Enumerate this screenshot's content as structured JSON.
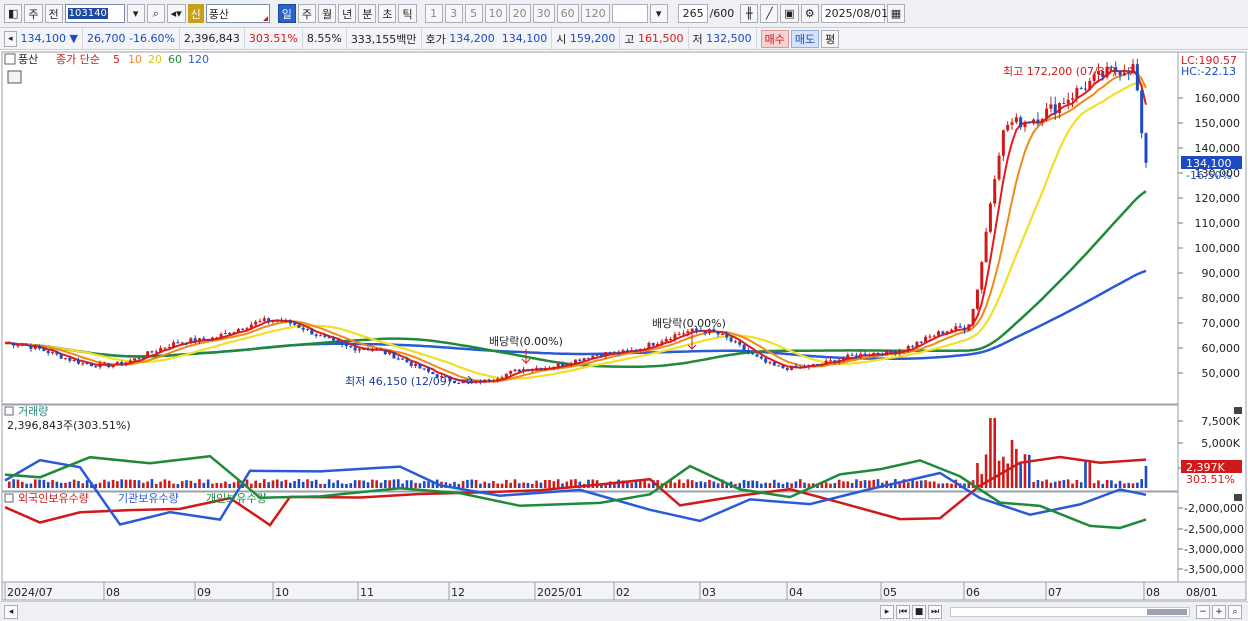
{
  "toolbar": {
    "market": "주",
    "prev": "전",
    "code": "103140",
    "sin": "신",
    "name": "풍산",
    "periods": [
      "일",
      "주",
      "월",
      "년",
      "분",
      "초",
      "틱"
    ],
    "active_period": "일",
    "intervals": [
      "1",
      "3",
      "5",
      "10",
      "20",
      "30",
      "60",
      "120"
    ],
    "count": "265",
    "total": "/600",
    "date": "2025/08/01"
  },
  "quote": {
    "price": "134,100",
    "arrow": "▼",
    "change": "26,700",
    "change_pct": "-16.60%",
    "volume": "2,396,843",
    "vol_ratio": "303.51%",
    "turnover": "8.55%",
    "amount": "333,155백만",
    "hoga_label": "호가",
    "ask": "134,200",
    "bid": "134,100",
    "open_label": "시",
    "open": "159,200",
    "high_label": "고",
    "high": "161,500",
    "low_label": "저",
    "low": "132,500",
    "buy": "매수",
    "sell": "매도",
    "eval": "평"
  },
  "price_panel": {
    "stock_tag": "풍산",
    "legend_prefix": "종가 단순",
    "ma": [
      {
        "p": "5",
        "color": "#e01c1c"
      },
      {
        "p": "10",
        "color": "#ef8a1a"
      },
      {
        "p": "20",
        "color": "#e8e020"
      },
      {
        "p": "60",
        "color": "#1e8a3a"
      },
      {
        "p": "120",
        "color": "#2a5ad8"
      }
    ],
    "lc": "LC:190.57",
    "hc": "HC:-22.13",
    "current_price": "134,100",
    "current_pct": "-16.50%",
    "max_note": "최고 172,200 (07/30)",
    "min_note": "최저 46,150 (12/09)",
    "div1": "배당락(0.00%)",
    "div2": "배당락(0.00%)",
    "y_ticks": [
      "160,000",
      "150,000",
      "140,000",
      "130,000",
      "120,000",
      "110,000",
      "100,000",
      "90,000",
      "80,000",
      "70,000",
      "60,000",
      "50,000"
    ]
  },
  "volume_panel": {
    "title": "거래량",
    "value": "2,396,843주(303.51%)",
    "y_ticks": [
      "7,500K",
      "5,000K",
      "2,500K"
    ],
    "current": "2,397K",
    "current_pct": "303.51%"
  },
  "holding_panel": {
    "labels": [
      "외국인보유수량",
      "기관보유수량",
      "개인보유수량"
    ],
    "y_ticks": [
      "-2,000,000",
      "-2,500,000",
      "-3,000,000",
      "-3,500,000"
    ]
  },
  "x_axis": [
    "2024/07",
    "08",
    "09",
    "10",
    "11",
    "12",
    "2025/01",
    "02",
    "03",
    "04",
    "05",
    "06",
    "07",
    "08"
  ],
  "x_right": "08/01",
  "chart_data": {
    "type": "candlestick",
    "series_close_anchors": [
      {
        "date": "2024/07",
        "close": 62000
      },
      {
        "date": "2024/08",
        "close": 53000
      },
      {
        "date": "2024/09",
        "close": 63000
      },
      {
        "date": "2024/10",
        "close": 71000
      },
      {
        "date": "2024/11",
        "close": 60000
      },
      {
        "date": "2024/12/09",
        "close": 46150
      },
      {
        "date": "2025/01",
        "close": 52000
      },
      {
        "date": "2025/02",
        "close": 58000
      },
      {
        "date": "2025/03",
        "close": 67000
      },
      {
        "date": "2025/04",
        "close": 52000
      },
      {
        "date": "2025/05",
        "close": 58000
      },
      {
        "date": "2025/06",
        "close": 68000
      },
      {
        "date": "2025/06/20",
        "close": 150000
      },
      {
        "date": "2025/07/30",
        "close": 172200
      },
      {
        "date": "2025/08/01",
        "close": 134100
      }
    ],
    "ylim": [
      45000,
      175000
    ]
  }
}
